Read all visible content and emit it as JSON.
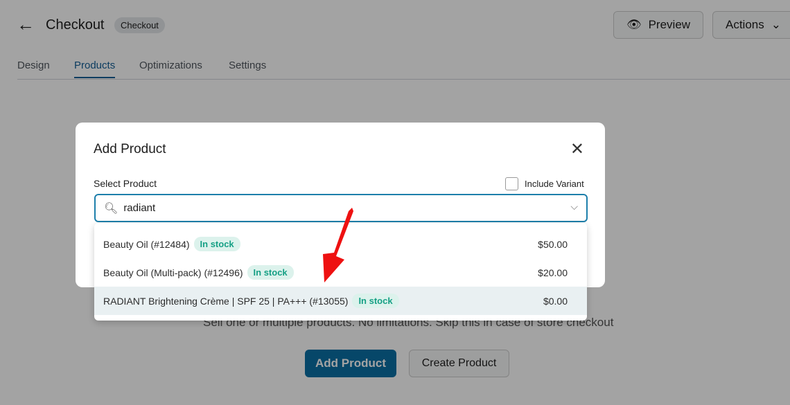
{
  "header": {
    "title": "Checkout",
    "badge": "Checkout",
    "preview": "Preview",
    "actions": "Actions"
  },
  "tabs": [
    {
      "label": "Design"
    },
    {
      "label": "Products"
    },
    {
      "label": "Optimizations"
    },
    {
      "label": "Settings"
    }
  ],
  "empty": {
    "description": "Sell one or multiple products. No limitations. Skip this in case of store checkout",
    "add": "Add Product",
    "create": "Create Product"
  },
  "modal": {
    "title": "Add Product",
    "select_label": "Select Product",
    "include_variant": "Include Variant",
    "include_variant_checked": false,
    "search_value": "radiant",
    "results": [
      {
        "name": "Beauty Oil (#12484)",
        "stock": "In stock",
        "price": "$50.00"
      },
      {
        "name": "Beauty Oil (Multi-pack) (#12496)",
        "stock": "In stock",
        "price": "$20.00"
      },
      {
        "name": "RADIANT Brightening Crème | SPF 25 | PA+++ (#13055)",
        "stock": "In stock",
        "price": "$0.00",
        "highlighted": true
      }
    ]
  },
  "colors": {
    "accent": "#135e96",
    "stock": "#16a085",
    "arrow": "#ee1111"
  }
}
